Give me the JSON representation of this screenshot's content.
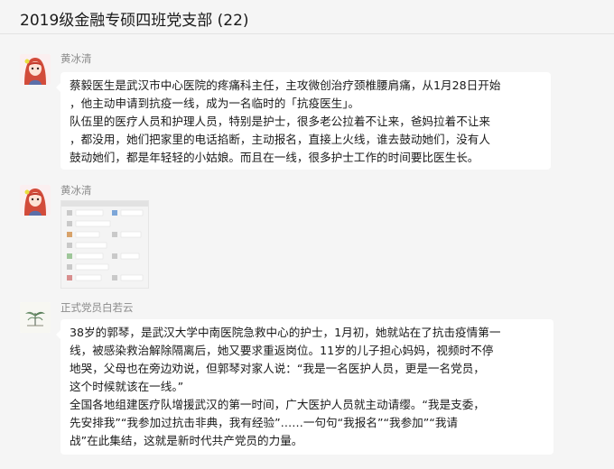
{
  "window": {
    "title": "2019级金融专硕四班党支部 (22)"
  },
  "messages": [
    {
      "sender": "黄冰清",
      "avatar_icon": "anime-girl-avatar",
      "type": "text",
      "lines": [
        "蔡毅医生是武汉市中心医院的疼痛科主任，主攻微创治疗颈椎腰肩痛，从1月28日开始",
        "，他主动申请到抗疫一线，成为一名临时的「抗疫医生」。",
        "队伍里的医疗人员和护理人员，特别是护士，很多老公拉着不让来，爸妈拉着不让来",
        "，都没用，她们把家里的电话掐断，主动报名，直接上火线，谁去鼓动她们，没有人",
        "鼓动她们，都是年轻轻的小姑娘。而且在一线，很多护士工作的时间要比医生长。"
      ]
    },
    {
      "sender": "黄冰清",
      "avatar_icon": "anime-girl-avatar",
      "type": "image",
      "image_icon": "chat-screenshot-thumbnail"
    },
    {
      "sender": "正式党员白若云",
      "avatar_icon": "plant-sketch-avatar",
      "type": "text",
      "lines": [
        "38岁的郭琴，是武汉大学中南医院急救中心的护士，1月初，她就站在了抗击疫情第一",
        "线，被感染救治解除隔离后，她又要求重返岗位。11岁的儿子担心妈妈，视频时不停",
        "地哭，父母也在旁边劝说，但郭琴对家人说：“我是一名医护人员，更是一名党员，",
        "这个时候就该在一线。”",
        "全国各地组建医疗队增援武汉的第一时间，广大医护人员就主动请缨。“我是支委，",
        "先安排我”“我参加过抗击非典，我有经验”……一句句“我报名”“我参加”“我请",
        "战”在此集结，这就是新时代共产党员的力量。"
      ]
    }
  ]
}
